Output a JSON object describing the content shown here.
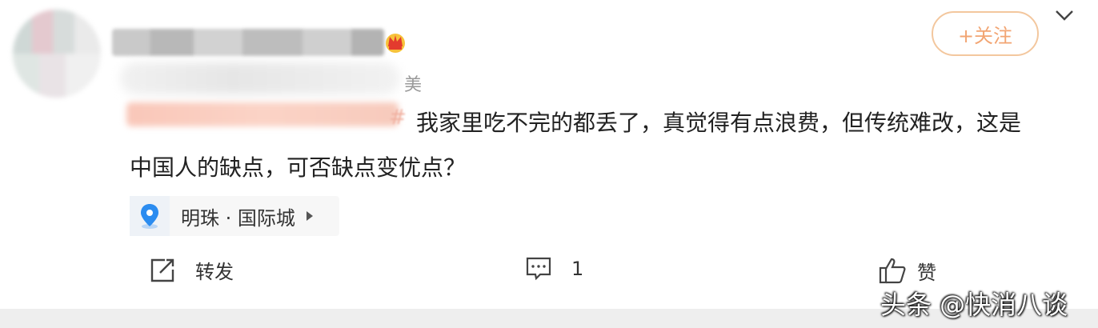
{
  "post": {
    "text_line1": "我家里吃不完的都丢了，真觉得有点浪费，但传统难改，这是",
    "text_line2": "中国人的缺点，可否缺点变优点？",
    "meta_tail": "美"
  },
  "follow_button": {
    "label": "+关注"
  },
  "location": {
    "label": "明珠 · 国际城",
    "icon": "location-pin-icon"
  },
  "actions": {
    "repost": {
      "label": "转发",
      "icon": "share-icon"
    },
    "comment": {
      "label": "1",
      "icon": "comment-icon"
    },
    "like": {
      "label": "赞",
      "icon": "thumbs-up-icon"
    }
  },
  "watermark": {
    "text": "头条 @快消八谈"
  },
  "colors": {
    "accent": "#f2a573",
    "follow_border": "#f3c79e",
    "pin": "#2b8cf0"
  }
}
